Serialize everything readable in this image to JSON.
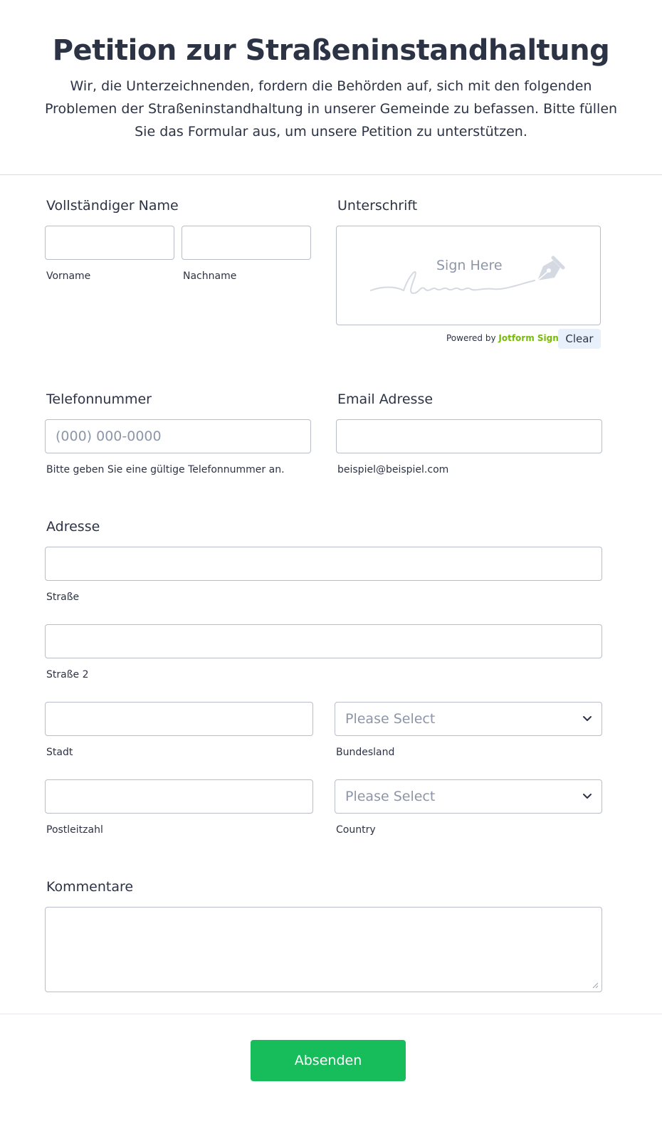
{
  "header": {
    "title": "Petition zur Straßeninstandhaltung",
    "subtitle": "Wir, die Unterzeichnenden, fordern die Behörden auf, sich mit den folgenden Problemen der Straßeninstandhaltung in unserer Gemeinde zu befassen. Bitte füllen Sie das Formular aus, um unsere Petition zu unterstützen."
  },
  "name": {
    "label": "Vollständiger Name",
    "first_value": "",
    "first_sublabel": "Vorname",
    "last_value": "",
    "last_sublabel": "Nachname"
  },
  "signature": {
    "label": "Unterschrift",
    "placeholder": "Sign Here",
    "powered_prefix": "Powered by",
    "powered_brand": "Jotform Sign",
    "clear_label": "Clear"
  },
  "phone": {
    "label": "Telefonnummer",
    "placeholder": "(000) 000-0000",
    "sublabel": "Bitte geben Sie eine gültige Telefonnummer an."
  },
  "email": {
    "label": "Email Adresse",
    "value": "",
    "sublabel": "beispiel@beispiel.com"
  },
  "address": {
    "label": "Adresse",
    "street_sublabel": "Straße",
    "street2_sublabel": "Straße 2",
    "city_sublabel": "Stadt",
    "state_placeholder": "Please Select",
    "state_sublabel": "Bundesland",
    "zip_sublabel": "Postleitzahl",
    "country_placeholder": "Please Select",
    "country_sublabel": "Country"
  },
  "comments": {
    "label": "Kommentare",
    "value": ""
  },
  "submit": {
    "label": "Absenden"
  },
  "colors": {
    "submit": "#18bd5b",
    "brand": "#78bb07",
    "text": "#2c3345",
    "placeholder": "#8d96a8",
    "border": "#b8bdc9"
  }
}
